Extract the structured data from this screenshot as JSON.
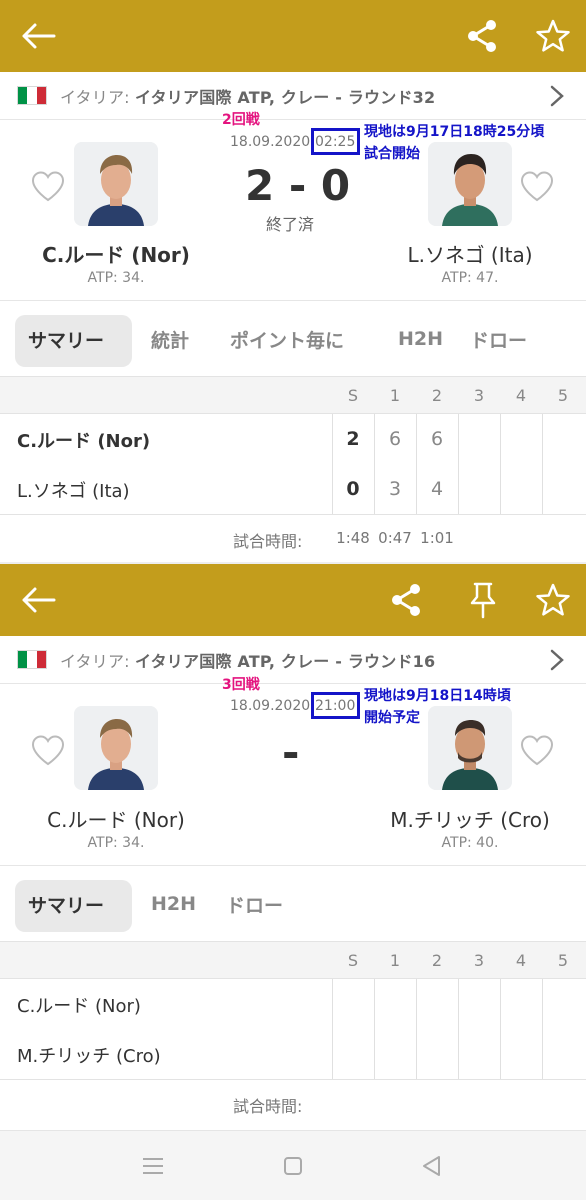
{
  "match1": {
    "league_country": "イタリア: ",
    "league_name": "イタリア国際 ATP, クレー - ラウンド32",
    "round_note": "2回戦",
    "date": "18.09.2020",
    "time": "02:25",
    "local_note_line1": "現地は9月17日18時25分頃",
    "local_note_line2": "試合開始",
    "score": "2 - 0",
    "status": "終了済",
    "player1": {
      "name": "C.ルード (Nor)",
      "rank": "ATP: 34."
    },
    "player2": {
      "name": "L.ソネゴ (Ita)",
      "rank": "ATP: 47."
    },
    "tabs": [
      "サマリー",
      "統計",
      "ポイント毎に",
      "H2H",
      "ドロー"
    ],
    "active_tab": "サマリー",
    "set_headers": [
      "S",
      "1",
      "2",
      "3",
      "4",
      "5"
    ],
    "rows": [
      {
        "name": "C.ルード (Nor)",
        "s": "2",
        "sets": [
          "6",
          "6",
          "",
          "",
          ""
        ]
      },
      {
        "name": "L.ソネゴ (Ita)",
        "s": "0",
        "sets": [
          "3",
          "4",
          "",
          "",
          ""
        ]
      }
    ],
    "duration_label": "試合時間:",
    "durations": [
      "1:48",
      "0:47",
      "1:01"
    ]
  },
  "match2": {
    "league_country": "イタリア: ",
    "league_name": "イタリア国際 ATP, クレー - ラウンド16",
    "round_note": "3回戦",
    "date": "18.09.2020",
    "time": "21:00",
    "local_note_line1": "現地は9月18日14時頃",
    "local_note_line2": "開始予定",
    "score": "-",
    "player1": {
      "name": "C.ルード (Nor)",
      "rank": "ATP: 34."
    },
    "player2": {
      "name": "M.チリッチ (Cro)",
      "rank": "ATP: 40."
    },
    "tabs": [
      "サマリー",
      "H2H",
      "ドロー"
    ],
    "active_tab": "サマリー",
    "set_headers": [
      "S",
      "1",
      "2",
      "3",
      "4",
      "5"
    ],
    "rows": [
      {
        "name": "C.ルード (Nor)"
      },
      {
        "name": "M.チリッチ (Cro)"
      }
    ],
    "duration_label": "試合時間:"
  },
  "icons": {
    "back": "arrow-left-icon",
    "share": "share-icon",
    "pin": "pin-icon",
    "favorite": "star-icon",
    "follow": "heart-icon",
    "flag": "italy-flag",
    "chevron": "chevron-right-icon",
    "nav": [
      "menu-icon",
      "home-icon",
      "back-triangle-icon"
    ]
  },
  "colors": {
    "brand": "#c39d1c",
    "annotation_pink": "#e4137f",
    "annotation_blue": "#1414c8",
    "flag_green": "#009246",
    "flag_white": "#ffffff",
    "flag_red": "#ce2b37"
  }
}
